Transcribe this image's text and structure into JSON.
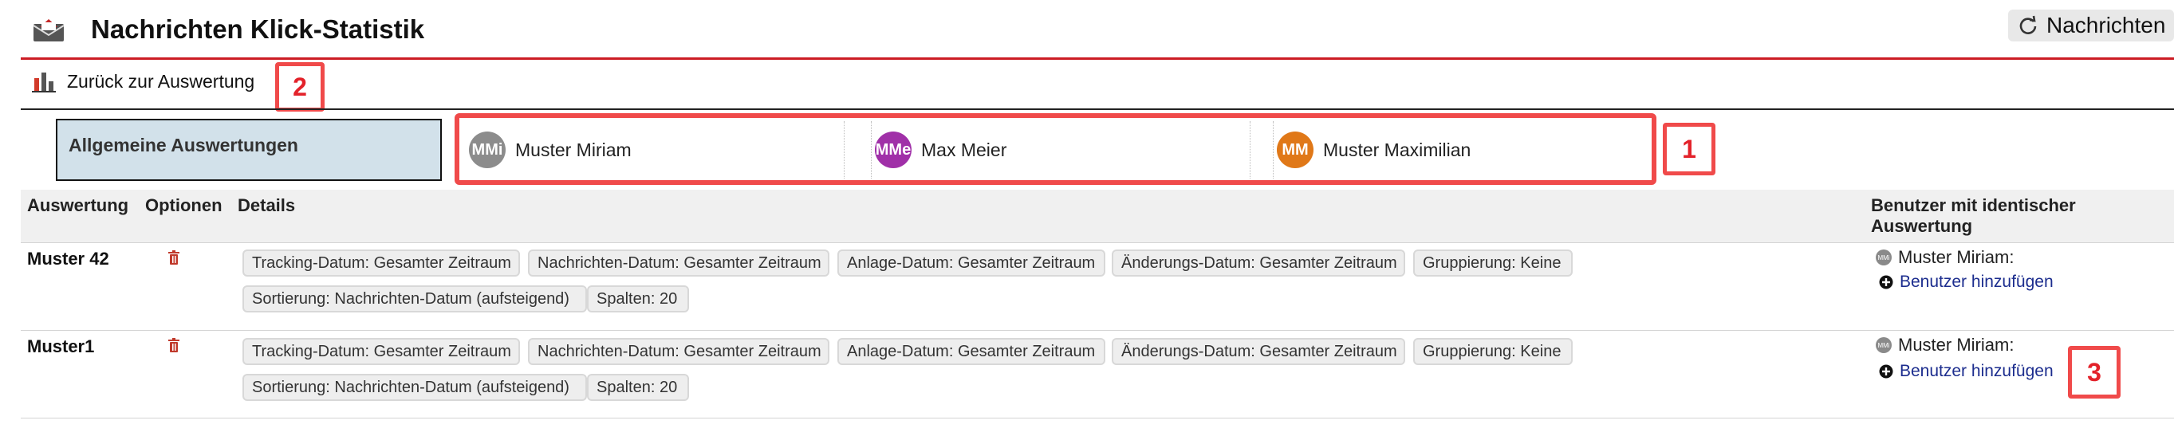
{
  "header": {
    "title": "Nachrichten Klick-Statistik",
    "reload_label": "Nachrichten"
  },
  "nav": {
    "back_label": "Zurück zur Auswertung"
  },
  "tabs": {
    "general_label": "Allgemeine Auswertungen",
    "users": [
      {
        "initials": "MMi",
        "name": "Muster Miriam",
        "color": "#8c8c8c"
      },
      {
        "initials": "MMe",
        "name": "Max Meier",
        "color": "#a030a8"
      },
      {
        "initials": "MM",
        "name": "Muster Maximilian",
        "color": "#e07818"
      }
    ]
  },
  "table": {
    "columns": {
      "evaluation": "Auswertung",
      "options": "Optionen",
      "details": "Details",
      "same_users_line1": "Benutzer mit identischer",
      "same_users_line2": "Auswertung"
    },
    "rows": [
      {
        "name": "Muster 42",
        "chips": [
          "Tracking-Datum: Gesamter Zeitraum",
          "Nachrichten-Datum: Gesamter Zeitraum",
          "Anlage-Datum: Gesamter Zeitraum",
          "Änderungs-Datum: Gesamter Zeitraum",
          "Gruppierung: Keine",
          "Sortierung: Nachrichten-Datum (aufsteigend)",
          "Spalten: 20"
        ],
        "same_user": "Muster Miriam:",
        "add_user": "Benutzer hinzufügen"
      },
      {
        "name": "Muster1",
        "chips": [
          "Tracking-Datum: Gesamter Zeitraum",
          "Nachrichten-Datum: Gesamter Zeitraum",
          "Anlage-Datum: Gesamter Zeitraum",
          "Änderungs-Datum: Gesamter Zeitraum",
          "Gruppierung: Keine",
          "Sortierung: Nachrichten-Datum (aufsteigend)",
          "Spalten: 20"
        ],
        "same_user": "Muster Miriam:",
        "add_user": "Benutzer hinzufügen"
      }
    ]
  },
  "annotations": {
    "tabs_callout": "1",
    "back_callout": "2",
    "add_user_callout": "3"
  },
  "colors": {
    "header_rule": "#cc1c24",
    "callout": "#f04a4a",
    "tab_active_bg": "#d2e1ea",
    "link": "#1c2d8e"
  }
}
